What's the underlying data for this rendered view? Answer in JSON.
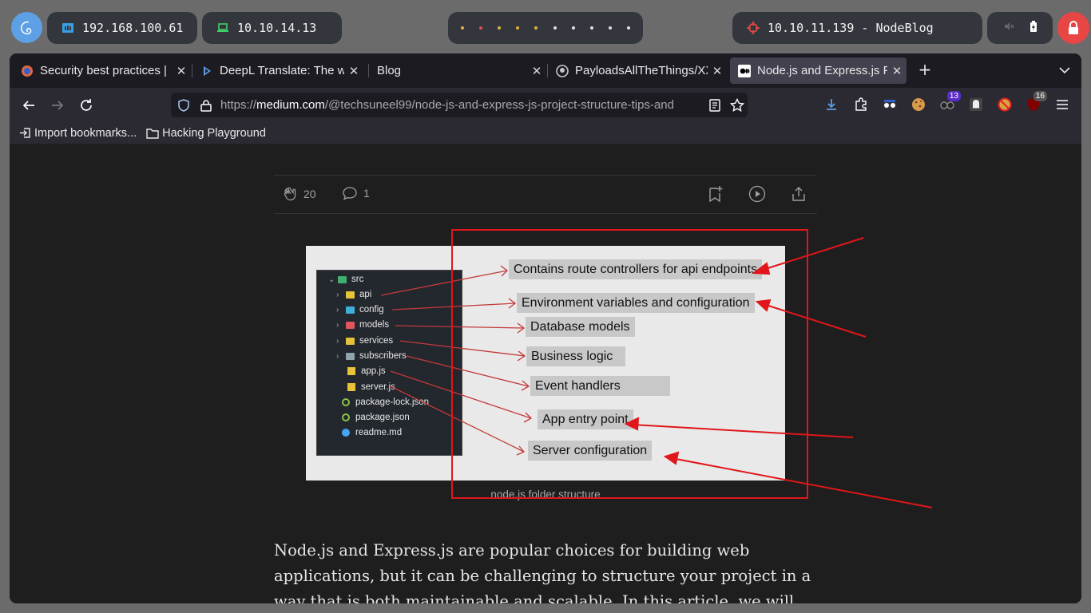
{
  "system_bar": {
    "ip_local": "192.168.100.61",
    "ip_vpn": "10.10.14.13",
    "target": "10.10.11.139 - NodeBlog",
    "workspace_dot_colors": [
      "#e0b040",
      "#e05050",
      "#e0b040",
      "#e0b040",
      "#e0b040",
      "#e0e0e0",
      "#e0e0e0",
      "#e0e0e0",
      "#e0e0e0",
      "#e0e0e0"
    ]
  },
  "tabs": [
    {
      "title": "Security best practices | ",
      "icon": "security-favicon",
      "active": false
    },
    {
      "title": "DeepL Translate: The wo",
      "icon": "deepl-favicon",
      "active": false
    },
    {
      "title": "Blog",
      "icon": "",
      "active": false
    },
    {
      "title": "PayloadsAllTheThings/XX",
      "icon": "github-favicon",
      "active": false
    },
    {
      "title": "Node.js and Express.js Pr",
      "icon": "medium-favicon",
      "active": true
    }
  ],
  "url": {
    "prefix": "https://",
    "host": "medium.com",
    "path": "/@techsuneel99/node-js-and-express-js-project-structure-tips-and"
  },
  "extensions": {
    "badge_1": "13",
    "badge_2": "16"
  },
  "bookmarks": [
    {
      "label": "Import bookmarks...",
      "icon": "import-icon"
    },
    {
      "label": "Hacking Playground",
      "icon": "folder-icon"
    }
  ],
  "article": {
    "claps": "20",
    "responses": "1",
    "figure": {
      "tree": {
        "root": "src",
        "items": [
          {
            "name": "api",
            "type": "folder",
            "color": "#e6c33b"
          },
          {
            "name": "config",
            "type": "folder",
            "color": "#3fb0d9"
          },
          {
            "name": "models",
            "type": "folder",
            "color": "#e05560"
          },
          {
            "name": "services",
            "type": "folder",
            "color": "#e6c33b"
          },
          {
            "name": "subscribers",
            "type": "folder",
            "color": "#90a4ae"
          },
          {
            "name": "app.js",
            "type": "js"
          },
          {
            "name": "server.js",
            "type": "js"
          },
          {
            "name": "package-lock.json",
            "type": "node"
          },
          {
            "name": "package.json",
            "type": "node"
          },
          {
            "name": "readme.md",
            "type": "info"
          }
        ]
      },
      "labels": [
        "Contains route controllers for api endpoints",
        "Environment variables and configuration",
        "Database models",
        "Business logic",
        "Event handlers",
        "App entry point",
        "Server configuration"
      ]
    },
    "caption": "node.js folder structure",
    "body": "Node.js and Express.js are popular choices for building web applications, but it can be challenging to structure your project in a way that is both maintainable and scalable. In this article, we will explore some best"
  }
}
